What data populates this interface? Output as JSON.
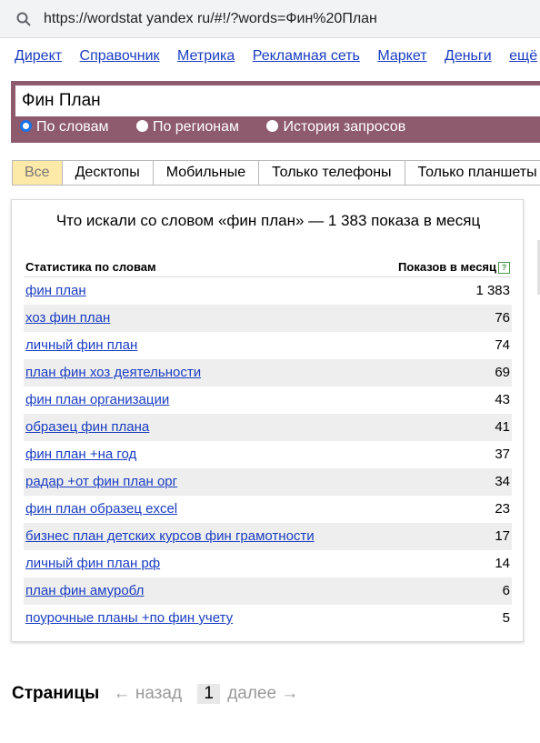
{
  "address_bar": {
    "url": "https://wordstat yandex ru/#!/?words=Фин%20План"
  },
  "top_nav": [
    "Директ",
    "Справочник",
    "Метрика",
    "Рекламная сеть",
    "Маркет",
    "Деньги",
    "ещё"
  ],
  "search": {
    "query": "Фин План",
    "radio_options": [
      "По словам",
      "По регионам",
      "История запросов"
    ],
    "selected_radio": "По словам"
  },
  "device_tabs": [
    "Все",
    "Десктопы",
    "Мобильные",
    "Только телефоны",
    "Только планшеты"
  ],
  "results": {
    "title": "Что искали со словом «фин план» — 1 383 показа в месяц",
    "col_phrase": "Статистика по словам",
    "col_count": "Показов в месяц",
    "help_glyph": "?",
    "rows": [
      {
        "phrase": "фин план",
        "count": "1 383"
      },
      {
        "phrase": "хоз фин план",
        "count": "76"
      },
      {
        "phrase": "личный фин план",
        "count": "74"
      },
      {
        "phrase": "план фин хоз деятельности",
        "count": "69"
      },
      {
        "phrase": "фин план организации",
        "count": "43"
      },
      {
        "phrase": "образец фин плана",
        "count": "41"
      },
      {
        "phrase": "фин план +на год",
        "count": "37"
      },
      {
        "phrase": "радар +от фин план орг",
        "count": "34"
      },
      {
        "phrase": "фин план образец excel",
        "count": "23"
      },
      {
        "phrase": "бизнес план детских курсов фин грамотности",
        "count": "17"
      },
      {
        "phrase": "личный фин план рф",
        "count": "14"
      },
      {
        "phrase": "план фин амуробл",
        "count": "6"
      },
      {
        "phrase": "поурочные планы +по фин учету",
        "count": "5"
      }
    ]
  },
  "pager": {
    "label": "Страницы",
    "prev": "← назад",
    "current": "1",
    "next": "далее →"
  },
  "colors": {
    "panel": "#8e5a6e",
    "link": "#1a3dc1",
    "active_tab": "#fde9a8",
    "row_alt": "#eeeeee"
  }
}
